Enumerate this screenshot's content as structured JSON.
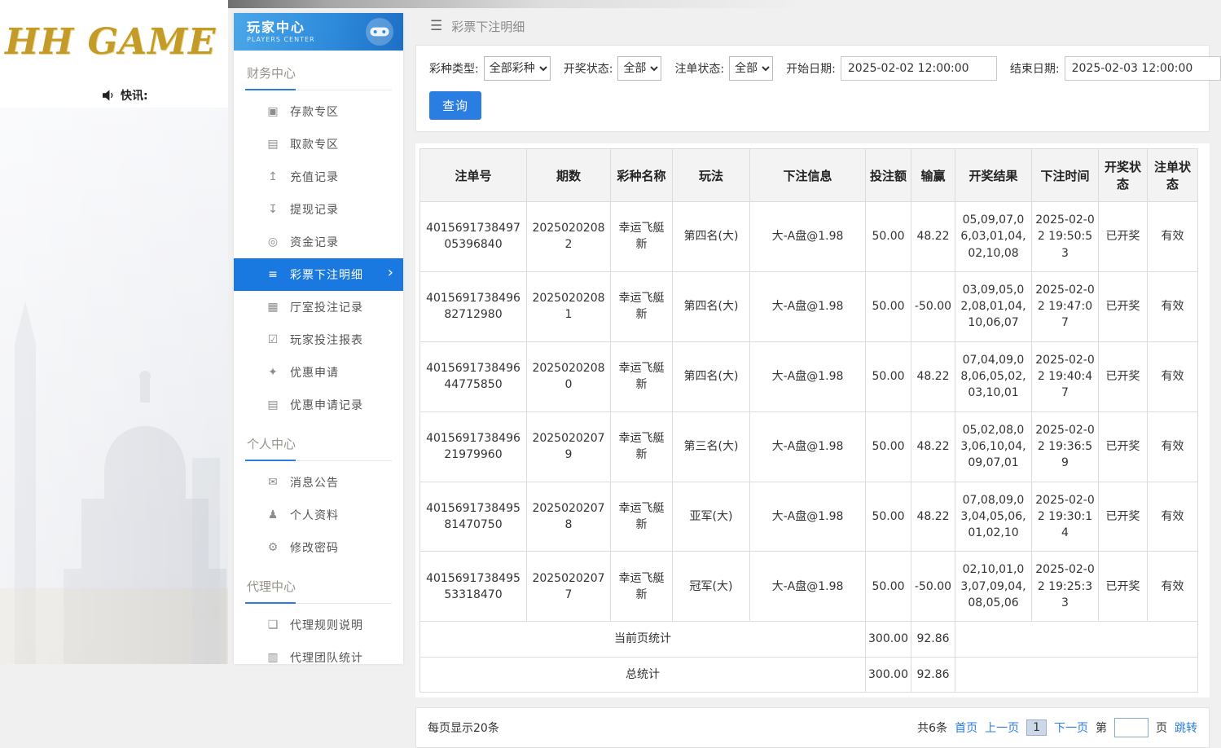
{
  "theme": {
    "accent_blue": "#2a7de1",
    "active_menu_blue": "#1a79e0",
    "link_blue": "#2a7de1",
    "brand_gold": "#c49a28",
    "header_gradient_start": "#4aa7e8",
    "header_gradient_end": "#1d6fc6",
    "table_header_bg": "#f3f3f3"
  },
  "brand": {
    "logo_text": "HH GAME",
    "news_label": "快讯:"
  },
  "sidebar": {
    "header": {
      "title": "玩家中心",
      "subtitle": "PLAYERS CENTER"
    },
    "sections": [
      {
        "title": "财务中心",
        "items": [
          {
            "label": "存款专区",
            "icon": "deposit-card-icon",
            "glyph": "▣"
          },
          {
            "label": "取款专区",
            "icon": "withdraw-icon",
            "glyph": "▤"
          },
          {
            "label": "充值记录",
            "icon": "recharge-record-icon",
            "glyph": "↥"
          },
          {
            "label": "提现记录",
            "icon": "cashout-record-icon",
            "glyph": "↧"
          },
          {
            "label": "资金记录",
            "icon": "funds-record-icon",
            "glyph": "◎"
          },
          {
            "label": "彩票下注明细",
            "icon": "lottery-bet-detail-icon",
            "glyph": "≡",
            "active": true
          },
          {
            "label": "厅室投注记录",
            "icon": "hall-bet-record-icon",
            "glyph": "▦"
          },
          {
            "label": "玩家投注报表",
            "icon": "player-bet-report-icon",
            "glyph": "☑"
          },
          {
            "label": "优惠申请",
            "icon": "promo-apply-icon",
            "glyph": "✦"
          },
          {
            "label": "优惠申请记录",
            "icon": "promo-record-icon",
            "glyph": "▤"
          }
        ]
      },
      {
        "title": "个人中心",
        "items": [
          {
            "label": "消息公告",
            "icon": "bell-icon",
            "glyph": "✉"
          },
          {
            "label": "个人资料",
            "icon": "person-icon",
            "glyph": "♟"
          },
          {
            "label": "修改密码",
            "icon": "gear-icon",
            "glyph": "⚙"
          }
        ]
      },
      {
        "title": "代理中心",
        "items": [
          {
            "label": "代理规则说明",
            "icon": "document-icon",
            "glyph": "❏"
          },
          {
            "label": "代理团队统计",
            "icon": "team-stats-icon",
            "glyph": "▥"
          }
        ]
      }
    ]
  },
  "topbar": {
    "title": "彩票下注明细"
  },
  "filters": {
    "lottery_type_label": "彩种类型:",
    "lottery_type_value": "全部彩种",
    "draw_status_label": "开奖状态:",
    "draw_status_value": "全部",
    "bet_status_label": "注单状态:",
    "bet_status_value": "全部",
    "start_date_label": "开始日期:",
    "start_date_value": "2025-02-02 12:00:00",
    "end_date_label": "结束日期:",
    "end_date_value": "2025-02-03 12:00:00",
    "query_button": "查询"
  },
  "table": {
    "headers": [
      "注单号",
      "期数",
      "彩种名称",
      "玩法",
      "下注信息",
      "投注额",
      "输赢",
      "开奖结果",
      "下注时间",
      "开奖状态",
      "注单状态"
    ],
    "rows": [
      [
        "401569173849705396840",
        "20250202082",
        "幸运飞艇新",
        "第四名(大)",
        "大-A盘@1.98",
        "50.00",
        "48.22",
        "05,09,07,06,03,01,04,02,10,08",
        "2025-02-02 19:50:53",
        "已开奖",
        "有效"
      ],
      [
        "401569173849682712980",
        "20250202081",
        "幸运飞艇新",
        "第四名(大)",
        "大-A盘@1.98",
        "50.00",
        "-50.00",
        "03,09,05,02,08,01,04,10,06,07",
        "2025-02-02 19:47:07",
        "已开奖",
        "有效"
      ],
      [
        "401569173849644775850",
        "20250202080",
        "幸运飞艇新",
        "第四名(大)",
        "大-A盘@1.98",
        "50.00",
        "48.22",
        "07,04,09,08,06,05,02,03,10,01",
        "2025-02-02 19:40:47",
        "已开奖",
        "有效"
      ],
      [
        "401569173849621979960",
        "20250202079",
        "幸运飞艇新",
        "第三名(大)",
        "大-A盘@1.98",
        "50.00",
        "48.22",
        "05,02,08,03,06,10,04,09,07,01",
        "2025-02-02 19:36:59",
        "已开奖",
        "有效"
      ],
      [
        "401569173849581470750",
        "20250202078",
        "幸运飞艇新",
        "亚军(大)",
        "大-A盘@1.98",
        "50.00",
        "48.22",
        "07,08,09,03,04,05,06,01,02,10",
        "2025-02-02 19:30:14",
        "已开奖",
        "有效"
      ],
      [
        "401569173849553318470",
        "20250202077",
        "幸运飞艇新",
        "冠军(大)",
        "大-A盘@1.98",
        "50.00",
        "-50.00",
        "02,10,01,03,07,09,04,08,05,06",
        "2025-02-02 19:25:33",
        "已开奖",
        "有效"
      ]
    ],
    "summary": [
      {
        "label": "当前页统计",
        "bet_total": "300.00",
        "win_total": "92.86"
      },
      {
        "label": "总统计",
        "bet_total": "300.00",
        "win_total": "92.86"
      }
    ]
  },
  "pagination": {
    "page_size_text": "每页显示20条",
    "total_text": "共6条",
    "first": "首页",
    "prev": "上一页",
    "current": "1",
    "next": "下一页",
    "page_prefix": "第",
    "page_suffix": "页",
    "jump": "跳转"
  }
}
